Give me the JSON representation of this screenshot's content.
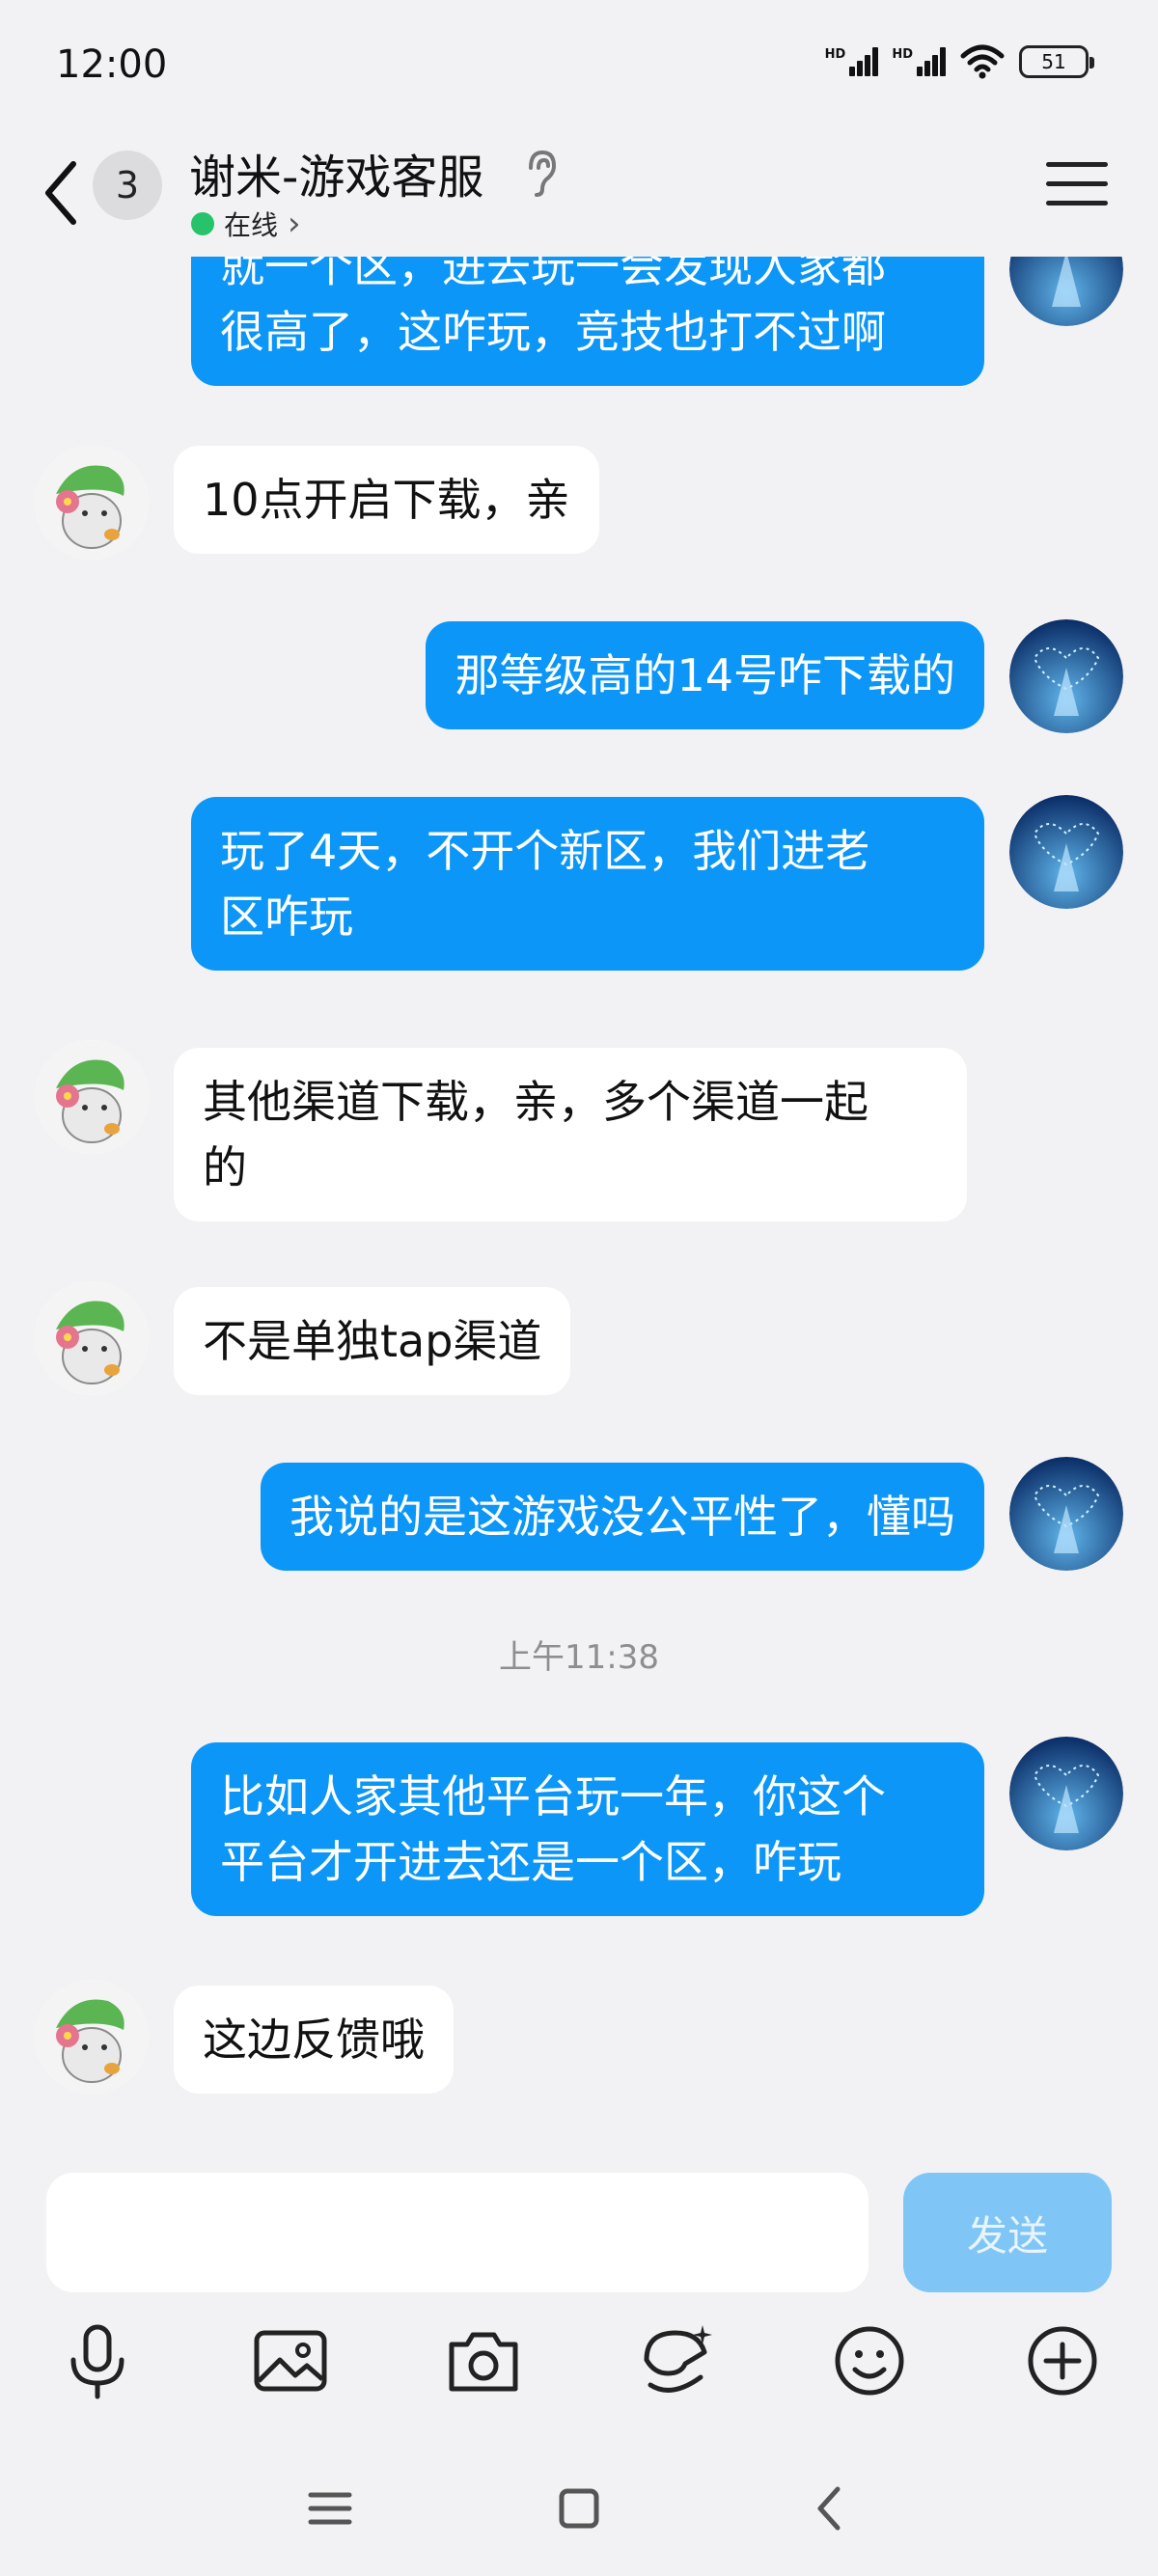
{
  "status_bar": {
    "time": "12:00",
    "hd1": "HD",
    "hd2": "HD",
    "battery": "51"
  },
  "header": {
    "unread_count": "3",
    "title": "谢米-游戏客服",
    "status": "在线",
    "status_chevron": "›"
  },
  "messages": [
    {
      "from": "out",
      "text": "就一个区，进去玩一会发现人家都很高了，这咋玩，竞技也打不过啊",
      "line1": "就一个区，进去玩一会发现人家都",
      "line2": "很高了，这咋玩，竞技也打不过啊"
    },
    {
      "from": "in",
      "text": "10点开启下载，亲"
    },
    {
      "from": "out",
      "text": "那等级高的14号咋下载的"
    },
    {
      "from": "out",
      "line1": "玩了4天，不开个新区，我们进老",
      "line2": "区咋玩"
    },
    {
      "from": "in",
      "line1": "其他渠道下载，亲，多个渠道一起",
      "line2": "的"
    },
    {
      "from": "in",
      "text": "不是单独tap渠道"
    },
    {
      "from": "out",
      "text": "我说的是这游戏没公平性了，懂吗"
    },
    {
      "from": "out",
      "line1": "比如人家其他平台玩一年，你这个",
      "line2": "平台才开进去还是一个区，咋玩"
    },
    {
      "from": "in",
      "text": "这边反馈哦"
    }
  ],
  "timestamp": "上午11:38",
  "composer": {
    "value": "",
    "placeholder": "",
    "send_label": "发送"
  },
  "colors": {
    "outgoing_bubble": "#0b96f8",
    "incoming_bubble": "#ffffff",
    "online": "#27c36a",
    "send_disabled": "#7fc6f7"
  },
  "toolbar_icons": [
    "microphone-icon",
    "image-icon",
    "camera-icon",
    "sticker-icon",
    "emoji-icon",
    "plus-icon"
  ],
  "nav_icons": [
    "menu-icon",
    "home-square-icon",
    "back-icon"
  ]
}
